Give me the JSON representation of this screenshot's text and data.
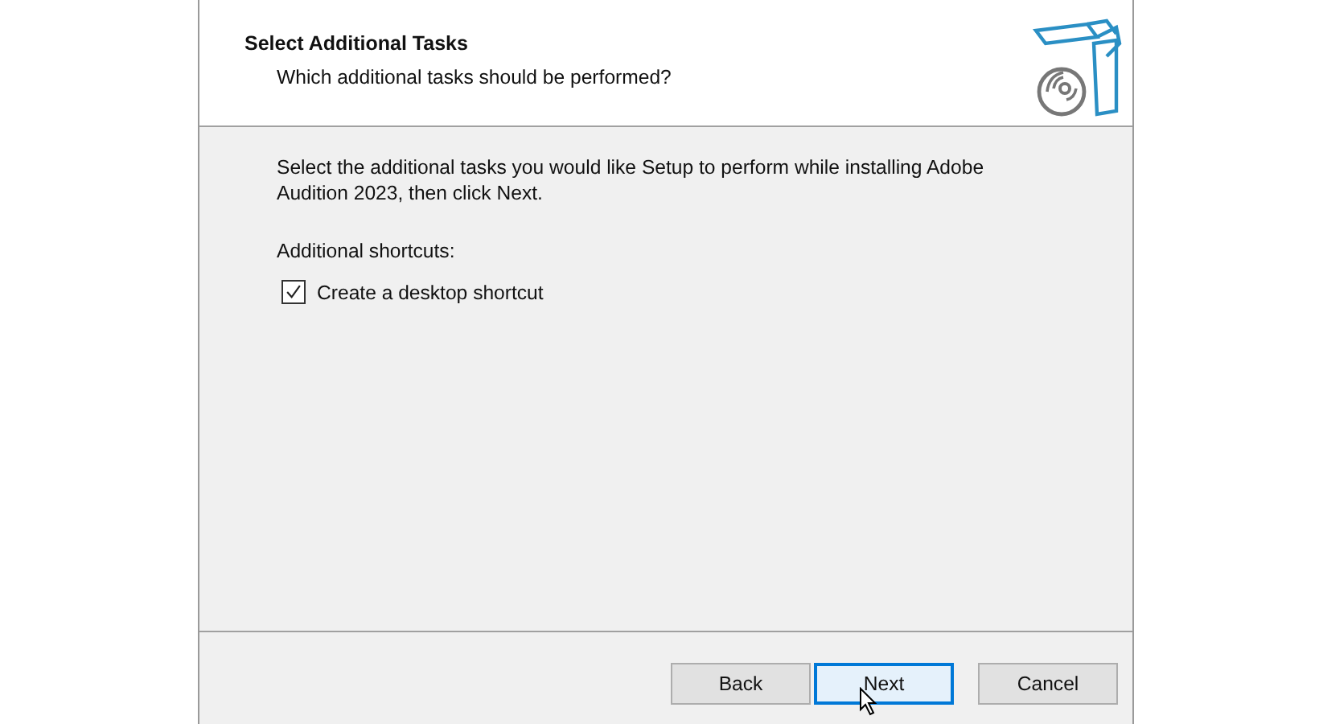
{
  "header": {
    "title": "Select Additional Tasks",
    "subtitle": "Which additional tasks should be performed?"
  },
  "body": {
    "intro": "Select the additional tasks you would like Setup to perform while installing Adobe Audition 2023, then click Next.",
    "group_label": "Additional shortcuts:",
    "options": [
      {
        "label": "Create a desktop shortcut",
        "checked": true
      }
    ]
  },
  "buttons": [
    {
      "label": "Back",
      "focused": false
    },
    {
      "label": "Next",
      "focused": true
    },
    {
      "label": "Cancel",
      "focused": false
    }
  ]
}
